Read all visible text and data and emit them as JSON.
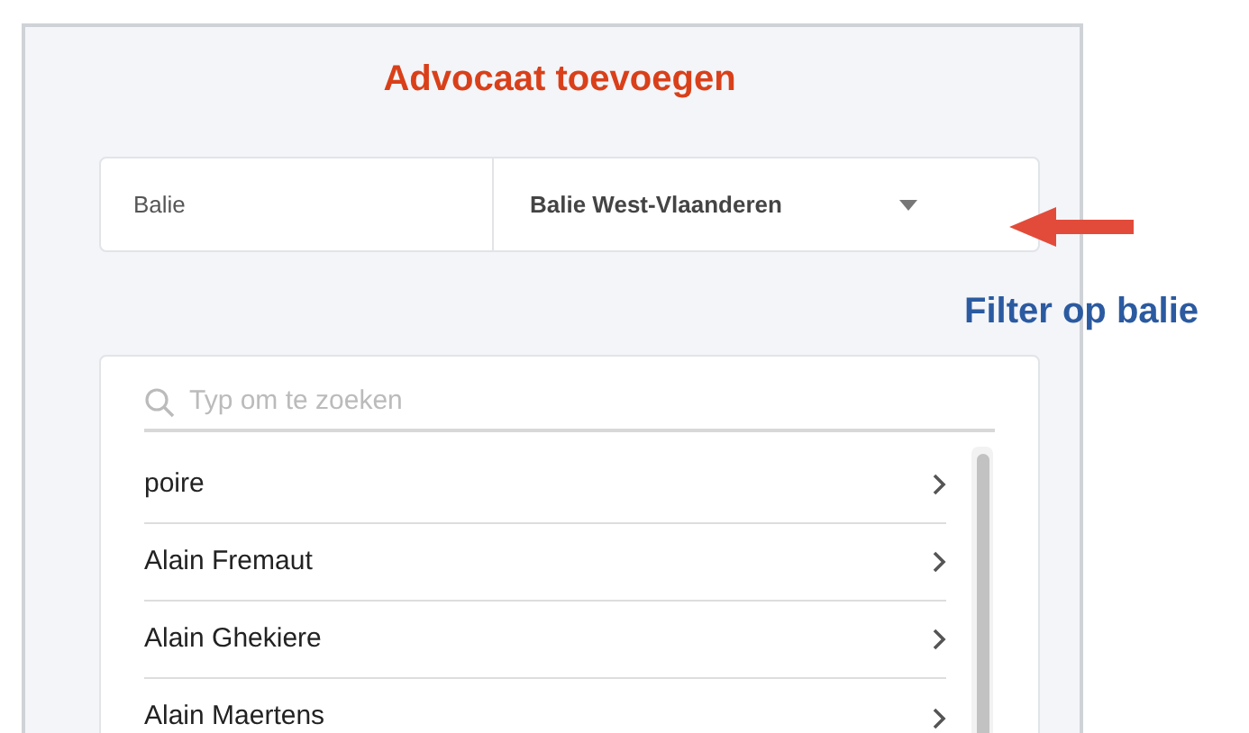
{
  "dialog": {
    "title": "Advocaat toevoegen"
  },
  "filter": {
    "label": "Balie",
    "value": "Balie West-Vlaanderen"
  },
  "search": {
    "placeholder": "Typ om te zoeken"
  },
  "results": [
    {
      "name": "poire"
    },
    {
      "name": "Alain Fremaut"
    },
    {
      "name": "Alain Ghekiere"
    },
    {
      "name": "Alain Maertens"
    }
  ],
  "annotation": {
    "text": "Filter op balie"
  }
}
